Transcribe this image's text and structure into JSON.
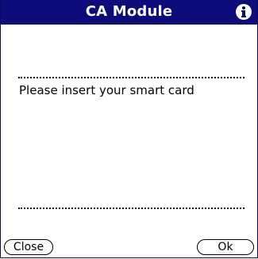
{
  "window": {
    "title": "CA Module"
  },
  "icons": {
    "info": "info-icon"
  },
  "content": {
    "message": "Please insert your smart card"
  },
  "buttons": {
    "close_label": "Close",
    "ok_label": "Ok"
  },
  "colors": {
    "titlebar": "#0c0c7a",
    "background": "#ffffff",
    "text": "#000000"
  }
}
